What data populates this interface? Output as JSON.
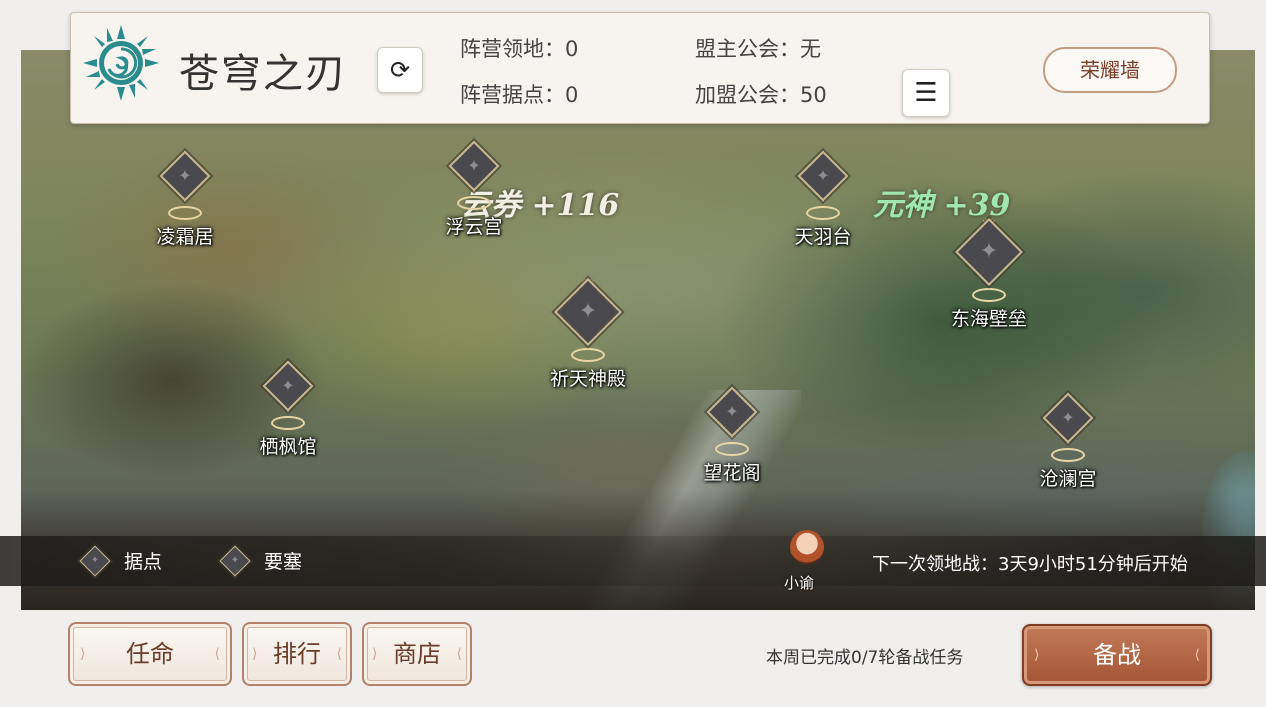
{
  "guild": {
    "name": "苍穹之刃",
    "emblem_icon": "sun-spiral-emblem",
    "stats": {
      "territory": "阵营领地：0",
      "strongholds": "阵营据点：0",
      "leader_guild": "盟主公会：无",
      "member_guilds": "加盟公会：50"
    },
    "honor_wall_label": "荣耀墙"
  },
  "map": {
    "locations": [
      {
        "name": "凌霜居",
        "type": "stronghold"
      },
      {
        "name": "浮云宫",
        "type": "stronghold"
      },
      {
        "name": "天羽台",
        "type": "stronghold"
      },
      {
        "name": "东海壁垒",
        "type": "fortress"
      },
      {
        "name": "祈天神殿",
        "type": "fortress"
      },
      {
        "name": "栖枫馆",
        "type": "stronghold"
      },
      {
        "name": "望花阁",
        "type": "stronghold"
      },
      {
        "name": "沧澜宫",
        "type": "stronghold"
      }
    ],
    "bonuses": [
      {
        "text": "云券 +116",
        "color": "#f3efe4"
      },
      {
        "text": "元神 +39",
        "color": "#9fe6b0"
      }
    ]
  },
  "legend": {
    "stronghold_label": "据点",
    "fortress_label": "要塞"
  },
  "npc": {
    "name": "小谕"
  },
  "next_battle": "下一次领地战：3天9小时51分钟后开始",
  "bottom": {
    "appoint_label": "任命",
    "rank_label": "排行",
    "shop_label": "商店",
    "weekly_progress": "本周已完成0/7轮备战任务",
    "prepare_label": "备战"
  },
  "colors": {
    "accent_brown": "#a45536",
    "marker_gold": "#e6d6a3",
    "emblem_teal": "#2a8c8c"
  }
}
